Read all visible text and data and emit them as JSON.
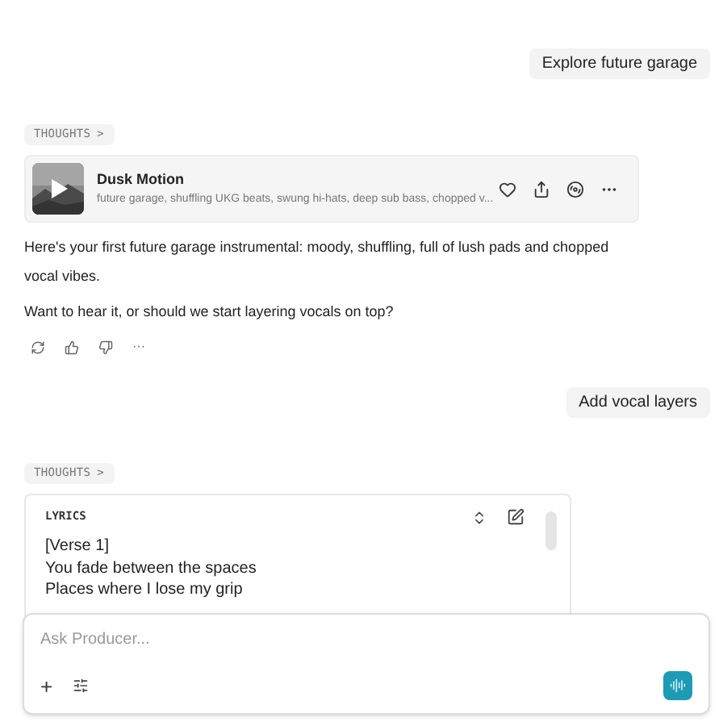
{
  "messages": [
    {
      "kind": "user",
      "text": "Explore future garage"
    },
    {
      "kind": "thoughts",
      "label": "THOUGHTS",
      "chevron": ">"
    },
    {
      "kind": "track",
      "title": "Dusk Motion",
      "tags": "future garage, shuffling UKG beats, swung hi-hats, deep sub bass, chopped v..."
    },
    {
      "kind": "assistant",
      "paragraphs": [
        "Here's your first future garage instrumental: moody, shuffling, full of lush pads and chopped vocal vibes.",
        "Want to hear it, or should we start layering vocals on top?"
      ],
      "more": "···"
    },
    {
      "kind": "user",
      "text": "Add vocal layers"
    },
    {
      "kind": "thoughts",
      "label": "THOUGHTS",
      "chevron": ">"
    },
    {
      "kind": "lyrics",
      "label": "LYRICS",
      "lines": [
        "[Verse 1]",
        "You fade between the spaces",
        "Places where I lose my grip"
      ]
    }
  ],
  "composer": {
    "placeholder": "Ask Producer...",
    "plus": "+"
  }
}
